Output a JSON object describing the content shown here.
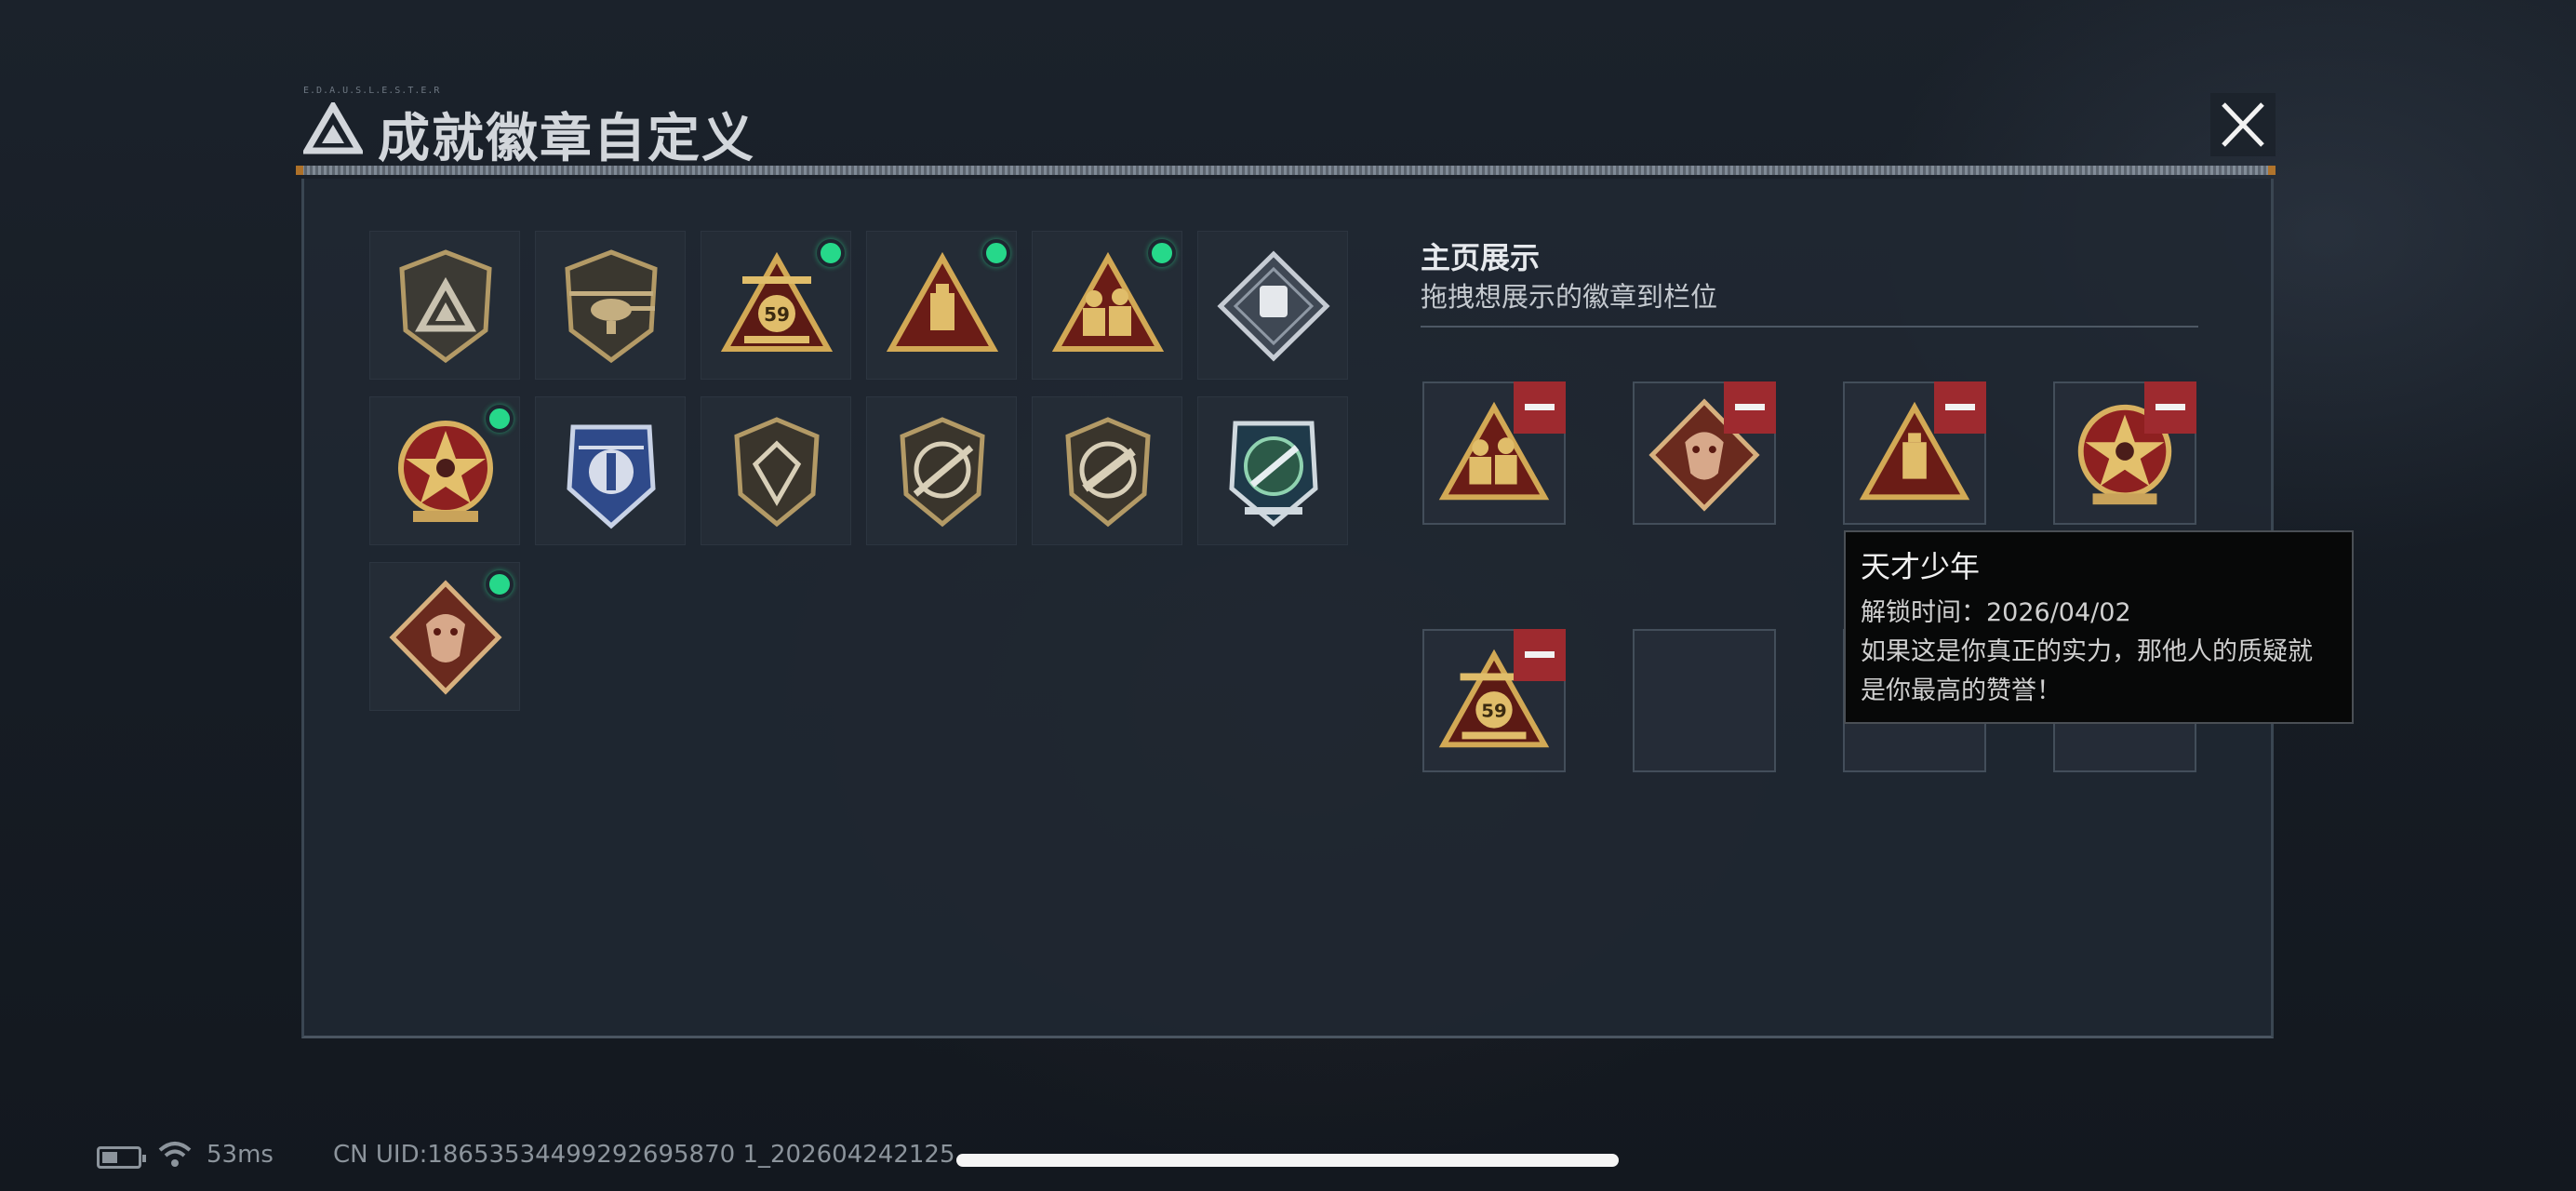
{
  "header": {
    "deco_text": "E.D.A.U.S.L.E.S.T.E.R",
    "title": "成就徽章自定义",
    "icon": "triangle-logo-icon",
    "close_icon": "close-icon"
  },
  "badges": [
    {
      "icon": "shield-triangle-badge-icon",
      "new": false
    },
    {
      "icon": "helicopter-badge-icon",
      "new": false
    },
    {
      "icon": "gold-59-badge-icon",
      "new": true
    },
    {
      "icon": "gold-triangle-bottle-badge-icon",
      "new": true
    },
    {
      "icon": "gold-triangle-soldiers-badge-icon",
      "new": true
    },
    {
      "icon": "silver-diamond-badge-icon",
      "new": false
    },
    {
      "icon": "red-star-skull-badge-icon",
      "new": true
    },
    {
      "icon": "blue-wings-badge-icon",
      "new": false
    },
    {
      "icon": "crystal-shield-badge-icon",
      "new": false
    },
    {
      "icon": "rifle-shield-badge-icon",
      "new": false
    },
    {
      "icon": "smg-shield-badge-icon",
      "new": false
    },
    {
      "icon": "green-missile-badge-icon",
      "new": false
    },
    {
      "icon": "dragon-diamond-badge-icon",
      "new": true
    }
  ],
  "showcase": {
    "title": "主页展示",
    "subtitle": "拖拽想展示的徽章到栏位",
    "slots": [
      {
        "icon": "gold-triangle-soldiers-badge-icon",
        "filled": true
      },
      {
        "icon": "dragon-diamond-badge-icon",
        "filled": true
      },
      {
        "icon": "gold-triangle-bottle-badge-icon",
        "filled": true
      },
      {
        "icon": "red-star-skull-badge-icon",
        "filled": true
      },
      {
        "icon": "gold-59-badge-icon",
        "filled": true
      },
      {
        "icon": "",
        "filled": false
      },
      {
        "icon": "",
        "filled": false
      },
      {
        "icon": "",
        "filled": false
      }
    ]
  },
  "tooltip": {
    "title": "天才少年",
    "unlock": "解锁时间：2026/04/02",
    "desc_line1": "如果这是你真正的实力，那他人的质疑就",
    "desc_line2": "是你最高的赞誉！"
  },
  "status_bar": {
    "ping": "53ms",
    "uid": "CN UID:18653534499292695870 1_202604242125"
  },
  "colors": {
    "new_dot": "#26d88a",
    "remove_btn": "#9e2a2f",
    "panel_bg": "#202832"
  }
}
